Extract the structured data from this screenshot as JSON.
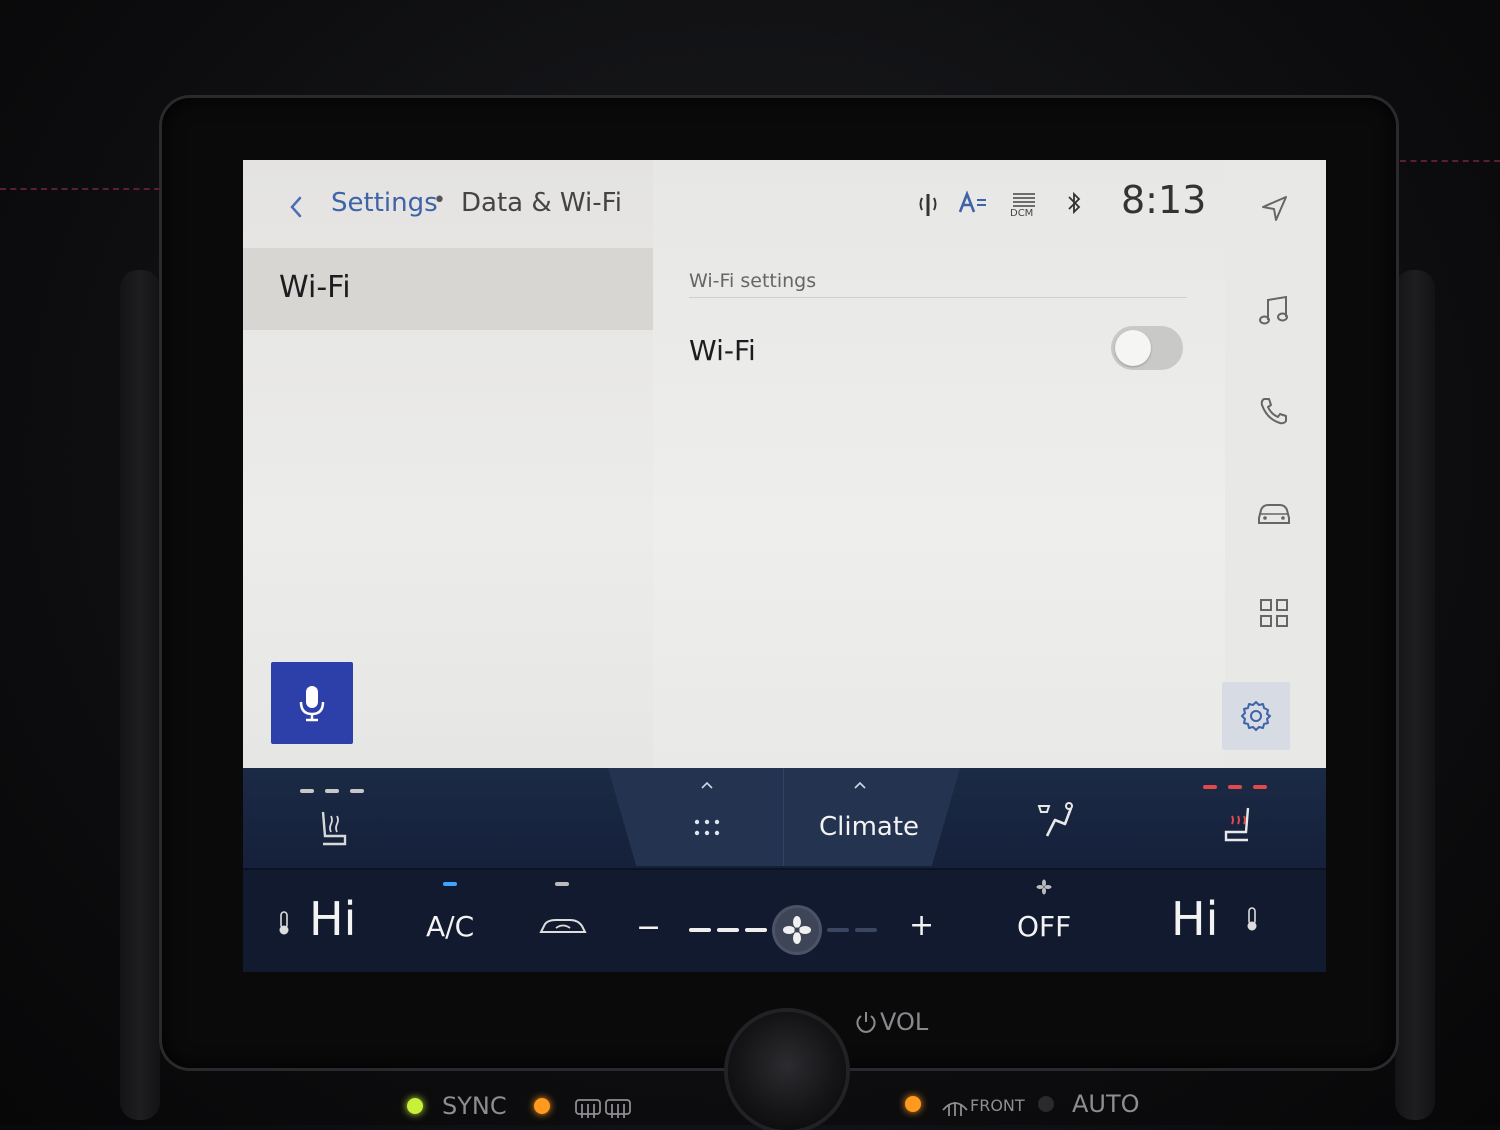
{
  "header": {
    "breadcrumb_parent": "Settings",
    "breadcrumb_separator": "•",
    "breadcrumb_current": "Data & Wi-Fi",
    "time": "8:13",
    "status_dcm": "DCM"
  },
  "left_menu": {
    "items": [
      {
        "label": "Wi-Fi",
        "selected": true
      }
    ]
  },
  "main": {
    "section_title": "Wi-Fi settings",
    "rows": [
      {
        "label": "Wi-Fi",
        "toggle_on": false
      }
    ]
  },
  "rail": {
    "items": [
      "navigation-icon",
      "music-icon",
      "phone-icon",
      "car-icon",
      "apps-icon",
      "settings-icon"
    ],
    "active": "settings-icon"
  },
  "climate": {
    "tab_label": "Climate",
    "driver_temp": "Hi",
    "passenger_temp": "Hi",
    "ac_label": "A/C",
    "fan_minus": "−",
    "fan_plus": "+",
    "fan_level": 0.55,
    "off_label": "OFF"
  },
  "hardware": {
    "vol_label": "VOL",
    "sync_label": "SYNC",
    "front_label": "FRONT",
    "auto_label": "AUTO"
  },
  "colors": {
    "accent_blue": "#3f63a8",
    "mic_button": "#2d3fa8",
    "climate_bg": "#15203a",
    "seat_heat_red": "#e04a4a"
  }
}
